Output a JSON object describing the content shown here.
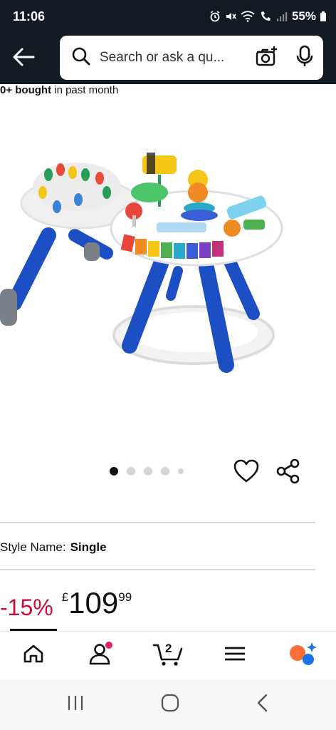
{
  "status_bar": {
    "time": "11:06",
    "battery": "55%"
  },
  "header": {
    "search_placeholder": "Search or ask a qu..."
  },
  "product": {
    "bought_count": "0+ bought",
    "bought_suffix": " in past month",
    "carousel": {
      "total": 5,
      "active_index": 0
    },
    "style_label": "Style Name:",
    "style_value": "Single",
    "discount": "-15%",
    "price_symbol": "£",
    "price_whole": "109",
    "price_fraction": "99"
  },
  "bottom_nav": {
    "cart_count": "2",
    "items": [
      "home-icon",
      "account-icon",
      "cart-icon",
      "menu-icon",
      "rufus-icon"
    ]
  },
  "colors": {
    "header_bg": "#131a22",
    "discount_red": "#cc0c39",
    "accent_orange": "#ff6d3a",
    "accent_blue": "#1a73e8"
  }
}
